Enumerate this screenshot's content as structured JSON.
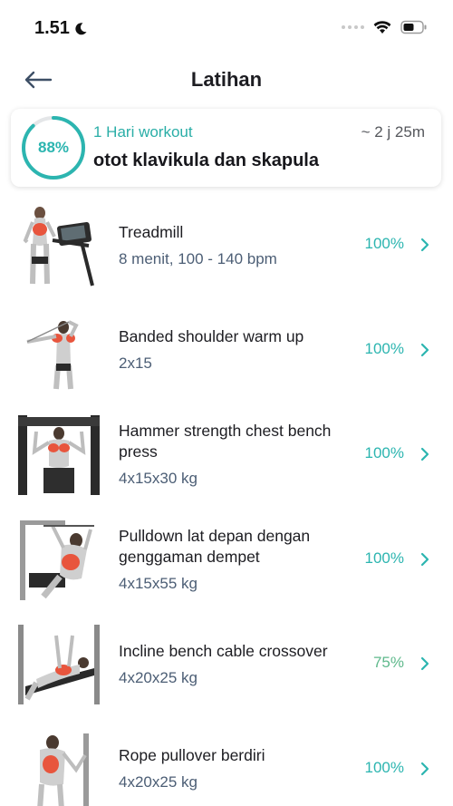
{
  "status_bar": {
    "time": "1.51"
  },
  "nav": {
    "title": "Latihan"
  },
  "summary": {
    "progress_percent": 88,
    "progress_label": "88%",
    "subtitle": "1 Hari workout",
    "duration": "~ 2 j 25m",
    "title": "otot klavikula dan skapula"
  },
  "colors": {
    "accent": "#2cb5b0",
    "accent_partial": "#5fb98c",
    "detail_text": "#4c5e75",
    "muscle_highlight": "#e8553d"
  },
  "exercises": [
    {
      "name": "Treadmill",
      "detail": "8 menit, 100 - 140 bpm",
      "percent": "100%",
      "icon": "treadmill-illustration"
    },
    {
      "name": "Banded shoulder warm up",
      "detail": "2x15",
      "percent": "100%",
      "icon": "banded-shoulder-illustration"
    },
    {
      "name": "Hammer strength chest bench press",
      "detail": "4x15x30 kg",
      "percent": "100%",
      "icon": "chest-press-illustration"
    },
    {
      "name": "Pulldown lat depan dengan genggaman dempet",
      "detail": "4x15x55 kg",
      "percent": "100%",
      "icon": "lat-pulldown-illustration"
    },
    {
      "name": "Incline bench cable crossover",
      "detail": "4x20x25 kg",
      "percent": "75%",
      "icon": "cable-crossover-illustration"
    },
    {
      "name": "Rope pullover berdiri",
      "detail": "4x20x25 kg",
      "percent": "100%",
      "icon": "rope-pullover-illustration"
    }
  ]
}
